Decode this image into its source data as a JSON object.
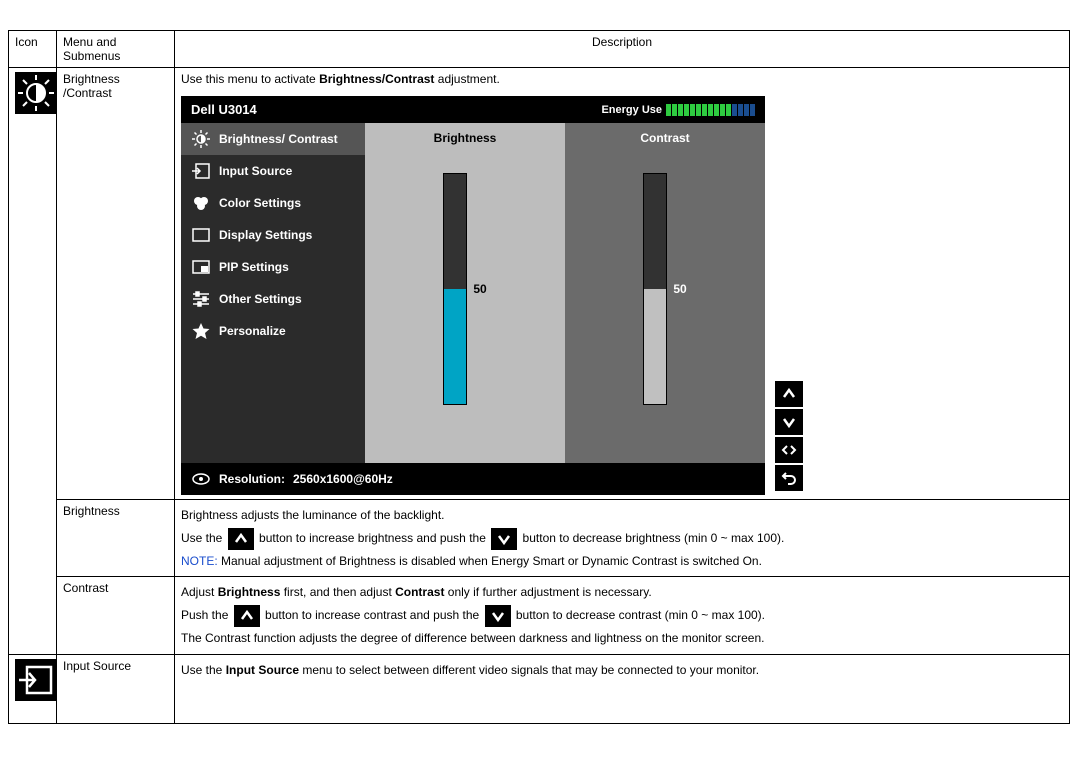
{
  "table": {
    "headers": {
      "icon": "Icon",
      "menu": "Menu and Submenus",
      "desc": "Description"
    },
    "rows": {
      "bc": {
        "menu": "Brightness /Contrast",
        "desc_pre": "Use this menu to activate ",
        "desc_bold": "Brightness/Contrast",
        "desc_post": " adjustment."
      },
      "brightness": {
        "menu": "Brightness",
        "line1": "Brightness adjusts the luminance of the backlight.",
        "line2_a": "Use the ",
        "line2_b": " button to increase brightness and push the ",
        "line2_c": " button to decrease brightness (min 0 ~ max 100).",
        "note_label": "NOTE:",
        "note_text": " Manual adjustment of Brightness is disabled when Energy Smart or Dynamic Contrast is switched On."
      },
      "contrast": {
        "menu": "Contrast",
        "line1_a": "Adjust ",
        "line1_b": "Brightness",
        "line1_c": " first, and then adjust ",
        "line1_d": "Contrast",
        "line1_e": " only if further adjustment is necessary.",
        "line2_a": "Push the ",
        "line2_b": " button to increase contrast and push the ",
        "line2_c": " button to decrease contrast (min 0 ~ max 100).",
        "line3": "The Contrast function adjusts the degree of difference between darkness and lightness on the monitor screen."
      },
      "input": {
        "menu": "Input Source",
        "line1_a": "Use the ",
        "line1_b": "Input Source",
        "line1_c": " menu to select between different video signals that may be connected to your monitor."
      }
    }
  },
  "osd": {
    "title": "Dell U3014",
    "energy_label": "Energy Use",
    "sidebar": [
      {
        "label": "Brightness/ Contrast",
        "icon": "brightness",
        "selected": true
      },
      {
        "label": "Input Source",
        "icon": "input",
        "selected": false
      },
      {
        "label": "Color Settings",
        "icon": "color",
        "selected": false
      },
      {
        "label": "Display Settings",
        "icon": "display",
        "selected": false
      },
      {
        "label": "PIP Settings",
        "icon": "pip",
        "selected": false
      },
      {
        "label": "Other Settings",
        "icon": "other",
        "selected": false
      },
      {
        "label": "Personalize",
        "icon": "star",
        "selected": false
      }
    ],
    "panel": {
      "brightness_label": "Brightness",
      "contrast_label": "Contrast",
      "brightness_value": "50",
      "contrast_value": "50"
    },
    "footer_label": "Resolution:",
    "footer_value": "2560x1600@60Hz"
  }
}
